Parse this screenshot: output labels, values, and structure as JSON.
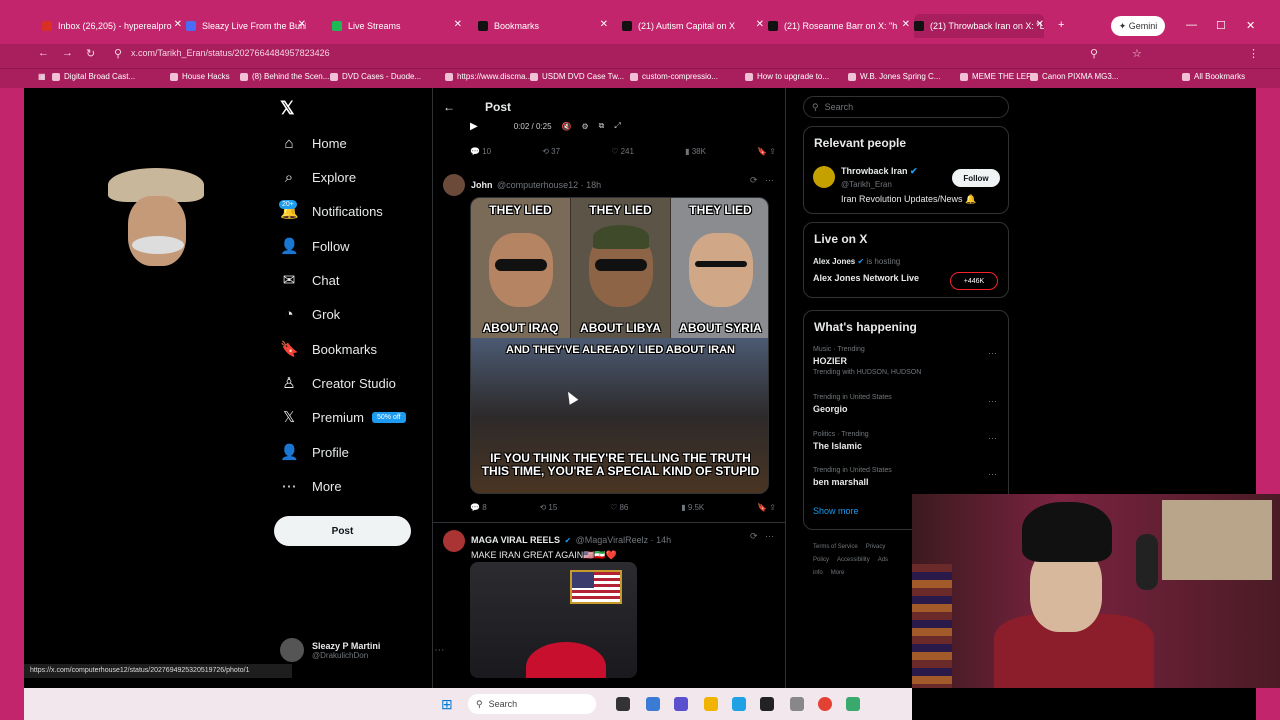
{
  "browser": {
    "tabs": [
      {
        "title": "Inbox (26,205) - hyperealpro",
        "active": false,
        "fav": "#d93025"
      },
      {
        "title": "Sleazy Live From the Bunker",
        "active": false,
        "fav": "#4a6cf7"
      },
      {
        "title": "Live Streams",
        "active": false,
        "fav": "#1db954"
      },
      {
        "title": "Bookmarks",
        "active": false,
        "fav": "#111"
      },
      {
        "title": "(21) Autism Capital on X",
        "active": false,
        "fav": "#111"
      },
      {
        "title": "(21) Roseanne Barr on X: \"h",
        "active": false,
        "fav": "#111"
      },
      {
        "title": "(21) Throwback Iran on X: \"L",
        "active": true,
        "fav": "#111"
      }
    ],
    "gemini_label": "Gemini",
    "url": "x.com/Tarikh_Eran/status/2027664484957823426",
    "bookmarks": [
      "Digital Broad Cast...",
      "House Hacks",
      "(8) Behind the Scen...",
      "DVD Cases - Duode...",
      "https://www.discma...",
      "USDM DVD Case Tw...",
      "custom-compressio...",
      "How to upgrade to...",
      "W.B. Jones Spring C...",
      "MEME THE LEFT",
      "Canon PIXMA MG3...",
      "All Bookmarks"
    ],
    "status_url": "https://x.com/computerhouse12/status/2027694925320519726/photo/1"
  },
  "sidebar": {
    "items": [
      {
        "label": "Home",
        "icon": "⌂"
      },
      {
        "label": "Explore",
        "icon": "⌕"
      },
      {
        "label": "Notifications",
        "icon": "🔔"
      },
      {
        "label": "Follow",
        "icon": "👤"
      },
      {
        "label": "Chat",
        "icon": "✉"
      },
      {
        "label": "Grok",
        "icon": "◔"
      },
      {
        "label": "Bookmarks",
        "icon": "🔖"
      },
      {
        "label": "Creator Studio",
        "icon": "♙"
      },
      {
        "label": "Premium",
        "icon": "𝕏"
      },
      {
        "label": "Profile",
        "icon": "👤"
      },
      {
        "label": "More",
        "icon": "⋯"
      }
    ],
    "notif_badge": "20+",
    "premium_badge": "50% off",
    "post_button": "Post",
    "user_name": "Sleazy P Martini",
    "user_handle": "@DrakulichDon"
  },
  "main": {
    "header": "Post",
    "video_time": "0:02 / 0:25",
    "actions1": {
      "replies": "10",
      "reposts": "37",
      "likes": "241",
      "views": "38K"
    },
    "tweet1": {
      "name": "John",
      "handle": "@computerhouse12 · 18h",
      "meme_top": [
        "THEY LIED",
        "THEY LIED",
        "THEY LIED"
      ],
      "meme_bottom": [
        "ABOUT IRAQ",
        "ABOUT LIBYA",
        "ABOUT SYRIA"
      ],
      "meme_mid": "AND THEY'VE ALREADY LIED ABOUT IRAN",
      "meme_caption": "IF YOU THINK THEY'RE TELLING THE TRUTH THIS TIME, YOU'RE A SPECIAL KIND OF STUPID"
    },
    "actions2": {
      "replies": "8",
      "reposts": "15",
      "likes": "86",
      "views": "9.5K"
    },
    "tweet2": {
      "name": "MAGA VIRAL REELS",
      "handle": "@MagaViralReelz · 14h",
      "text": "MAKE IRAN GREAT AGAIN🇺🇸🇮🇷❤️"
    }
  },
  "right": {
    "search_placeholder": "Search",
    "relevant_title": "Relevant people",
    "person_name": "Throwback Iran",
    "person_handle": "@Tarikh_Eran",
    "person_bio": "Iran Revolution Updates/News 🔔",
    "follow_label": "Follow",
    "live_title": "Live on X",
    "live_host": "Alex Jones",
    "live_hosting": "is hosting",
    "live_show": "Alex Jones Network Live",
    "live_count": "+446K",
    "happening_title": "What's happening",
    "trends": [
      {
        "meta": "Music · Trending",
        "name": "HOZIER",
        "extra": "Trending with HUDSON, HUDSON"
      },
      {
        "meta": "Trending in United States",
        "name": "Georgio",
        "extra": ""
      },
      {
        "meta": "Politics · Trending",
        "name": "The Islamic",
        "extra": ""
      },
      {
        "meta": "Trending in United States",
        "name": "ben marshall",
        "extra": ""
      }
    ],
    "show_more": "Show more",
    "footer": [
      "Terms of Service",
      "Privacy Policy",
      "Accessibility",
      "Ads info",
      "More"
    ]
  },
  "taskbar": {
    "search": "Search"
  }
}
